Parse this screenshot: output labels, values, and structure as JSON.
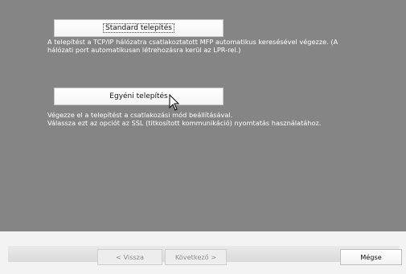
{
  "options": {
    "standard": {
      "label": "Standard telepítés",
      "description_line1": "A telepítést a TCP/IP hálózatra csatlakoztatott MFP automatikus keresésével végezze. (A",
      "description_line2": "hálózati port automatikusan létrehozásra kerül az LPR-rel.)"
    },
    "custom": {
      "label": "Egyéni telepítés",
      "description_line1": "Végezze el a telepítést a csatlakozási mód beállításával.",
      "description_line2": "Válassza ezt az opciót az SSL (titkosított kommunikáció) nyomtatás használatához."
    }
  },
  "footer": {
    "back_label": "< Vissza",
    "next_label": "Következő >",
    "cancel_label": "Mégse"
  },
  "colors": {
    "panel_background": "#858585",
    "description_text": "#ffffff",
    "disabled_text": "#8e8e8e"
  },
  "icons": {
    "pointer": "mouse-pointer-arrow-icon"
  }
}
